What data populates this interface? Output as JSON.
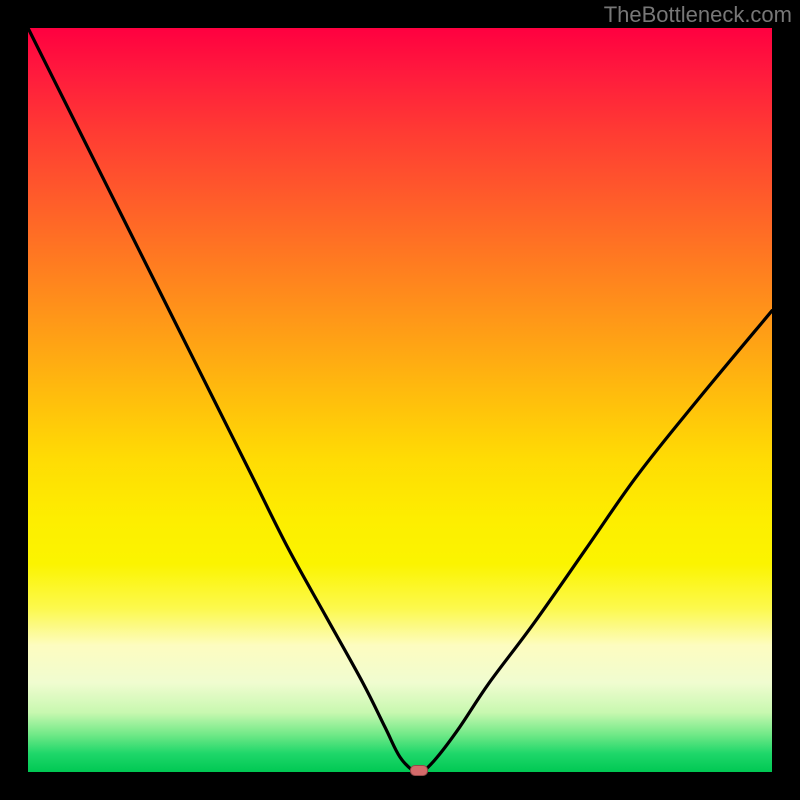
{
  "watermark": "TheBottleneck.com",
  "chart_data": {
    "type": "line",
    "title": "",
    "xlabel": "",
    "ylabel": "",
    "xlim": [
      0,
      100
    ],
    "ylim": [
      0,
      100
    ],
    "grid": false,
    "legend": false,
    "series": [
      {
        "name": "bottleneck-curve",
        "x": [
          0,
          5,
          10,
          15,
          20,
          25,
          30,
          35,
          40,
          45,
          48,
          50,
          52,
          53,
          55,
          58,
          62,
          68,
          75,
          82,
          90,
          100
        ],
        "y": [
          100,
          90,
          80,
          70,
          60,
          50,
          40,
          30,
          21,
          12,
          6,
          2,
          0,
          0,
          2,
          6,
          12,
          20,
          30,
          40,
          50,
          62
        ]
      }
    ],
    "annotations": [
      {
        "name": "minimum-marker",
        "x": 52.5,
        "y": 0
      }
    ],
    "background_gradient": {
      "direction": "vertical",
      "stops": [
        {
          "pos": 0.0,
          "color": "#ff0040"
        },
        {
          "pos": 0.5,
          "color": "#ffbf0c"
        },
        {
          "pos": 0.72,
          "color": "#fbf400"
        },
        {
          "pos": 0.9,
          "color": "#c8f8b0"
        },
        {
          "pos": 1.0,
          "color": "#00c853"
        }
      ]
    }
  },
  "marker": {
    "color": "#d46a6a"
  }
}
